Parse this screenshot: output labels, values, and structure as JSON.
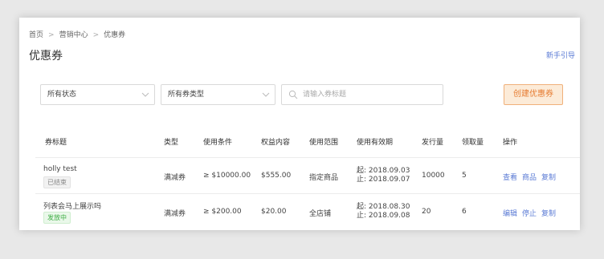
{
  "breadcrumb": [
    "首页",
    "营销中心",
    "优惠券"
  ],
  "breadcrumb_separator": ">",
  "page_title": "优惠券",
  "guide_link": "新手引导",
  "filters": {
    "status_select": "所有状态",
    "type_select": "所有券类型",
    "search_placeholder": "请输入券标题",
    "search_value": ""
  },
  "create_button": "创建优惠券",
  "table": {
    "headers": {
      "title": "券标题",
      "type": "类型",
      "condition": "使用条件",
      "benefit": "权益内容",
      "scope": "使用范围",
      "validity": "使用有效期",
      "issued": "发行量",
      "claimed": "领取量",
      "actions": "操作"
    },
    "rows": [
      {
        "title": "holly test",
        "status": "已结束",
        "type": "满减券",
        "condition": "≥ $10000.00",
        "benefit": "$555.00",
        "scope": "指定商品",
        "start": "起: 2018.09.03",
        "end": "止: 2018.09.07",
        "issued": "10000",
        "claimed": "5",
        "actions": [
          "查看",
          "商品",
          "复制"
        ]
      },
      {
        "title": "列表会马上展示吗",
        "status": "发放中",
        "type": "满减券",
        "condition": "≥ $200.00",
        "benefit": "$20.00",
        "scope": "全店铺",
        "start": "起: 2018.08.30",
        "end": "止: 2018.09.08",
        "issued": "20",
        "claimed": "6",
        "actions": [
          "编辑",
          "停止",
          "复制"
        ]
      }
    ]
  },
  "colors": {
    "link": "#5b7bd5",
    "create_button_text": "#e67a2e",
    "create_button_bg": "#fcebd8",
    "status_active": "#3fae45",
    "status_ended": "#888888"
  }
}
